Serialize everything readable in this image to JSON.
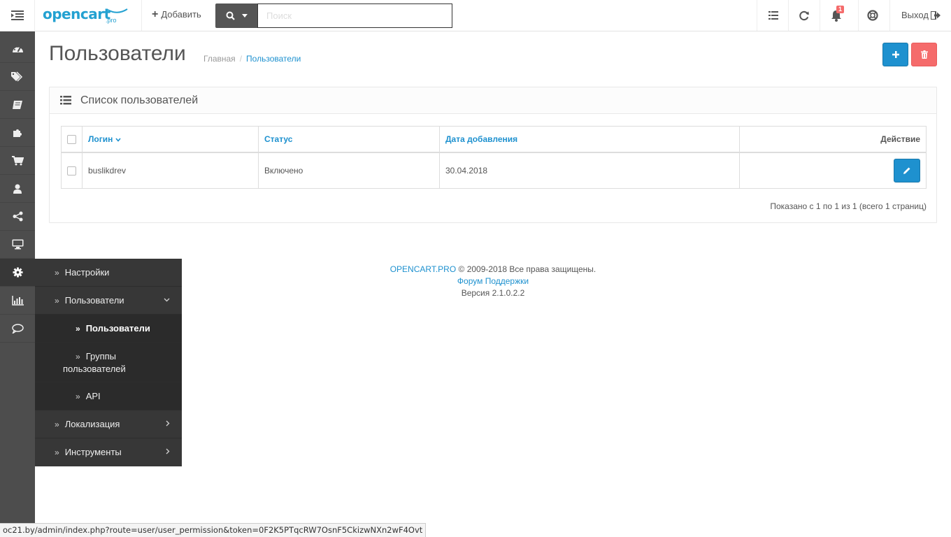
{
  "header": {
    "logo_text": "opencart",
    "logo_sub": ".pro",
    "add_label": "Добавить",
    "search_placeholder": "Поиск",
    "notification_count": "1",
    "logout_label": "Выход"
  },
  "sidebar": {
    "icons": [
      "dashboard-icon",
      "tags-icon",
      "book-icon",
      "puzzle-icon",
      "cart-icon",
      "user-icon",
      "share-icon",
      "desktop-icon",
      "cog-icon",
      "bar-chart-icon",
      "comment-icon"
    ],
    "active": "cog-icon"
  },
  "flyout": {
    "items": [
      {
        "label": "Настройки"
      },
      {
        "label": "Пользователи"
      },
      {
        "label": "Пользователи"
      },
      {
        "label_line1": "Группы",
        "label_line2": "пользователей"
      },
      {
        "label": "API"
      },
      {
        "label": "Локализация"
      },
      {
        "label": "Инструменты"
      }
    ]
  },
  "page": {
    "title": "Пользователи",
    "breadcrumb": [
      "Главная",
      "Пользователи"
    ]
  },
  "panel": {
    "title": "Список пользователей",
    "columns": [
      "Логин",
      "Статус",
      "Дата добавления",
      "Действие"
    ],
    "rows": [
      {
        "login": "buslikdrev",
        "status": "Включено",
        "date_added": "30.04.2018"
      }
    ],
    "pagination": "Показано с 1 по 1 из 1 (всего 1 страниц)"
  },
  "footer": {
    "brand": "OPENCART.PRO",
    "copyright": "© 2009-2018 Все права защищены.",
    "forum": "Форум Поддержки",
    "version": "Версия 2.1.0.2.2"
  },
  "statusbar": {
    "url": "oc21.by/admin/index.php?route=user/user_permission&token=0F2K5PTqcRW7OsnF5CkizwNXn2wF4Ovt"
  },
  "colors": {
    "primary": "#1e91cf",
    "danger": "#f56b6b",
    "sidebar": "#4d4d4d",
    "flyout": "#373737"
  }
}
